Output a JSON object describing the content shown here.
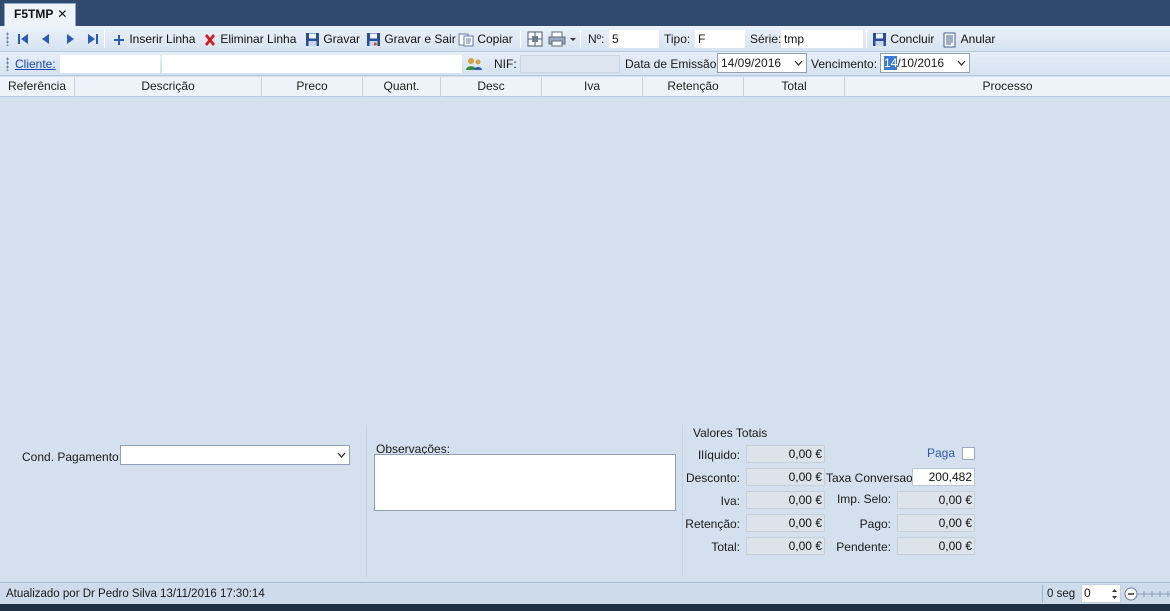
{
  "tab": {
    "title": "F5TMP",
    "close": "✕"
  },
  "toolbar": {
    "insert_line": "Inserir Linha",
    "delete_line": "Eliminar Linha",
    "save": "Gravar",
    "save_exit": "Gravar e Sair",
    "copy": "Copiar",
    "number_label": "Nº:",
    "number_value": "5",
    "type_label": "Tipo:",
    "type_value": "F",
    "series_label": "Série:",
    "series_value": "tmp",
    "conclude": "Concluir",
    "cancel": "Anular"
  },
  "header": {
    "client_label": "Cliente:",
    "client_code": "",
    "client_name": "",
    "nif_label": "NIF:",
    "nif_value": "",
    "issue_date_label": "Data de Emissão:",
    "issue_date": "14/09/2016",
    "due_label": "Vencimento:",
    "due_day": "14",
    "due_rest": "/10/2016"
  },
  "grid": {
    "columns": [
      "Referência",
      "Descrição",
      "Preco",
      "Quant.",
      "Desc",
      "Iva",
      "Retenção",
      "Total",
      "Processo"
    ]
  },
  "footer": {
    "payment_label": "Cond. Pagamento:",
    "payment_value": "",
    "notes_label": "Observações:",
    "totals_title": "Valores Totais",
    "paid_label": "Paga",
    "liquido_label": "Ilíquido:",
    "liquido": "0,00 €",
    "desconto_label": "Desconto:",
    "desconto": "0,00 €",
    "iva_label": "Iva:",
    "iva": "0,00 €",
    "retencao_label": "Retenção:",
    "retencao": "0,00 €",
    "total_label": "Total:",
    "total": "0,00 €",
    "taxa_label": "Taxa Conversao:",
    "taxa": "200,482",
    "selo_label": "Imp. Selo:",
    "selo": "0,00 €",
    "pago_label": "Pago:",
    "pago": "0,00 €",
    "pendente_label": "Pendente:",
    "pendente": "0,00 €"
  },
  "status": {
    "updated": "Atualizado por Dr Pedro Silva 13/11/2016 17:30:14",
    "seconds": "0 seg",
    "counter": "0"
  },
  "colors": {
    "accent": "#3a7bd5",
    "background": "#d4e0ee",
    "link": "#1a47b8"
  }
}
